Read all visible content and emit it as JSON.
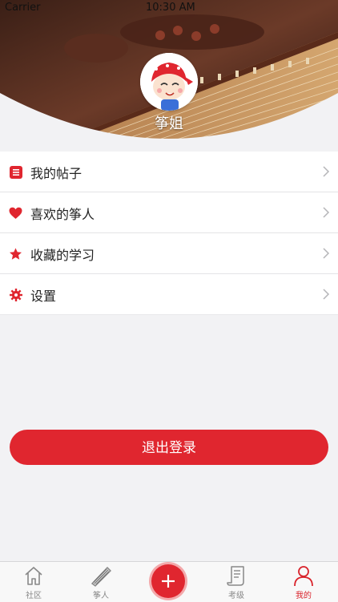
{
  "status_bar": {
    "carrier": "Carrier",
    "time": "10:30 AM"
  },
  "profile": {
    "name": "筝姐"
  },
  "menu": {
    "items": [
      {
        "label": "我的帖子",
        "icon": "list-icon"
      },
      {
        "label": "喜欢的筝人",
        "icon": "heart-icon"
      },
      {
        "label": "收藏的学习",
        "icon": "star-icon"
      },
      {
        "label": "设置",
        "icon": "gear-icon"
      }
    ]
  },
  "logout": {
    "label": "退出登录"
  },
  "tabbar": {
    "tabs": [
      {
        "label": "社区",
        "icon": "home-icon"
      },
      {
        "label": "筝人",
        "icon": "guzheng-icon"
      },
      {
        "label": "",
        "icon": "plus-icon"
      },
      {
        "label": "考级",
        "icon": "scroll-icon"
      },
      {
        "label": "我的",
        "icon": "person-icon"
      }
    ],
    "active_index": 4
  },
  "colors": {
    "accent": "#e0262f",
    "background": "#f2f2f4",
    "tab_active": "#d9232b",
    "tab_inactive": "#888888"
  }
}
